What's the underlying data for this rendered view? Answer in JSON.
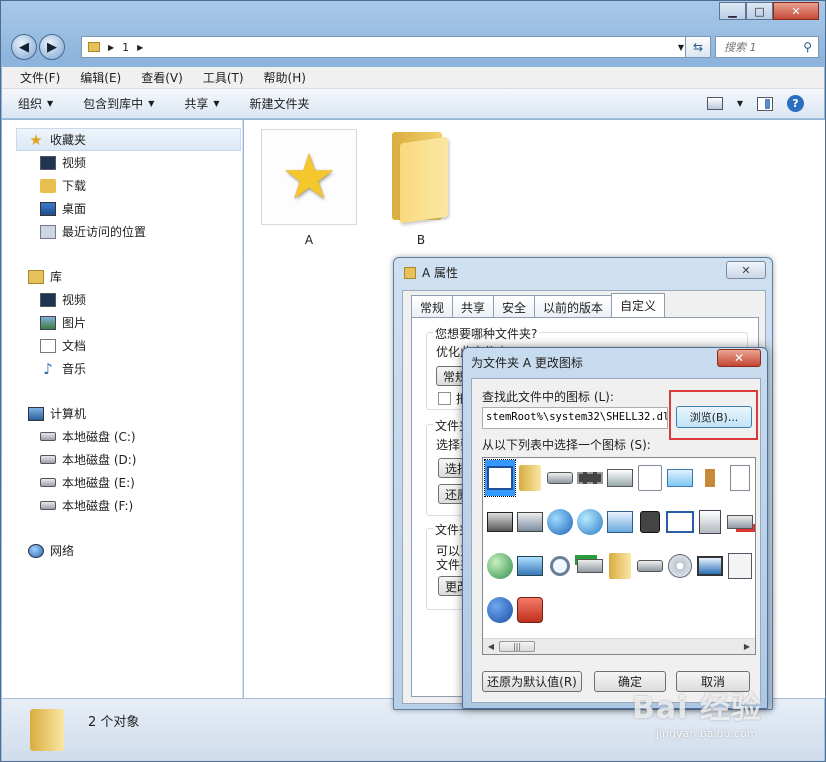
{
  "explorer": {
    "address_segment": "1",
    "search_placeholder": "搜索 1",
    "menus": [
      "文件(F)",
      "编辑(E)",
      "查看(V)",
      "工具(T)",
      "帮助(H)"
    ],
    "toolbar": [
      "组织",
      "包含到库中",
      "共享",
      "新建文件夹"
    ],
    "sidebar": {
      "favorites": {
        "label": "收藏夹",
        "items": [
          "视频",
          "下载",
          "桌面",
          "最近访问的位置"
        ]
      },
      "libraries": {
        "label": "库",
        "items": [
          "视频",
          "图片",
          "文档",
          "音乐"
        ]
      },
      "computer": {
        "label": "计算机",
        "items": [
          "本地磁盘 (C:)",
          "本地磁盘 (D:)",
          "本地磁盘 (E:)",
          "本地磁盘 (F:)"
        ]
      },
      "network": {
        "label": "网络"
      }
    },
    "files": [
      {
        "name": "A",
        "icon": "star-folder-icon"
      },
      {
        "name": "B",
        "icon": "folder-icon"
      }
    ],
    "status": "2 个对象"
  },
  "props_dialog": {
    "title": "A 属性",
    "tabs": [
      "常规",
      "共享",
      "安全",
      "以前的版本",
      "自定义"
    ],
    "active_tab": "自定义",
    "group1_label": "您想要哪种文件夹?",
    "optimize_text": "优化此文件夹:",
    "dropdown_value": "常规",
    "checkbox_label": "把",
    "group2_label": "文件夹",
    "group2_text": "选择要",
    "choose_btn": "选择",
    "restore_btn": "还原",
    "group3_label": "文件夹",
    "group3_text1": "可以更",
    "group3_text2": "文件夹",
    "change_btn": "更改"
  },
  "icon_dialog": {
    "title": "为文件夹 A 更改图标",
    "find_label": "查找此文件中的图标 (L):",
    "path_value": "stemRoot%\\system32\\SHELL32.dll",
    "browse_btn": "浏览(B)...",
    "list_label": "从以下列表中选择一个图标 (S):",
    "restore_btn": "还原为默认值(R)",
    "ok_btn": "确定",
    "cancel_btn": "取消",
    "icons": [
      "window-app-icon",
      "folder-icon",
      "drive-icon",
      "chip-icon",
      "printer-icon",
      "clock-icon",
      "window-icon",
      "floppy-icon",
      "document-icon",
      "computer-icon",
      "network-drive-icon",
      "globe-icon",
      "network-globe-icon",
      "control-panel-icon",
      "cd-icon",
      "blank-window-icon",
      "save-icon",
      "disconnected-drive-icon",
      "world-icon",
      "network-icon",
      "magnifier-icon",
      "remove-drive-icon",
      "folder-icon",
      "drive-icon",
      "cd-drive-icon",
      "monitor-icon",
      "calculator-icon",
      "help-icon",
      "power-icon"
    ]
  },
  "watermark": {
    "main": "Bai 经验",
    "sub": "jingyan.baidu.com"
  }
}
